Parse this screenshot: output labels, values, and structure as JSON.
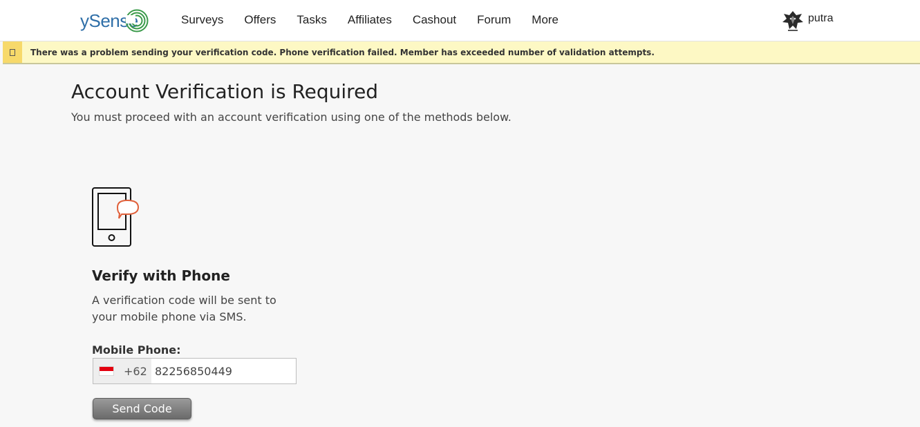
{
  "header": {
    "logo_text": "ySense",
    "nav": [
      "Surveys",
      "Offers",
      "Tasks",
      "Affiliates",
      "Cashout",
      "Forum",
      "More"
    ],
    "user": {
      "name": "putra",
      "avatar": "wolf-emblem-avatar"
    }
  },
  "alert": {
    "icon": "alert-icon",
    "message": "There was a problem sending your verification code. Phone verification failed. Member has exceeded number of validation attempts."
  },
  "page": {
    "title": "Account Verification is Required",
    "subtitle": "You must proceed with an account verification using one of the methods below."
  },
  "verify_phone": {
    "icon": "phone-sms-icon",
    "title": "Verify with Phone",
    "description": "A verification code will be sent to your mobile phone via SMS.",
    "field_label": "Mobile Phone:",
    "country_flag": "indonesia-flag",
    "dial_code": "+62",
    "phone_value": "82256850449",
    "send_button": "Send Code"
  },
  "colors": {
    "logo": "#2f6fa8",
    "logo_swirl": "#3a9a4a",
    "alert_background": "#fdf8c4",
    "alert_icon_background": "#f7d96a",
    "sms_bubble": "#e0603a",
    "button": "#7a7a7a",
    "flag_red": "#e3000f"
  }
}
